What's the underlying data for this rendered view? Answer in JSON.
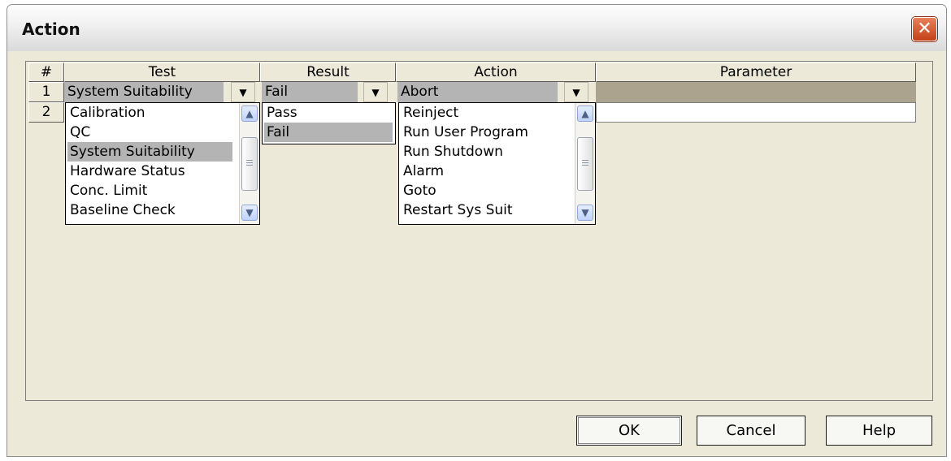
{
  "window": {
    "title": "Action",
    "close_glyph": "✕"
  },
  "grid": {
    "headers": {
      "num": "#",
      "test": "Test",
      "result": "Result",
      "action": "Action",
      "parameter": "Parameter"
    },
    "rows": [
      {
        "num": "1",
        "test": "System Suitability",
        "result": "Fail",
        "action": "Abort",
        "parameter": ""
      },
      {
        "num": "2"
      }
    ],
    "parameter_highlight_color": "#aba38e"
  },
  "dropdowns": {
    "test": {
      "items": [
        "Calibration",
        "QC",
        "System Suitability",
        "Hardware Status",
        "Conc. Limit",
        "Baseline Check"
      ],
      "selected": "System Suitability"
    },
    "result": {
      "items": [
        "Pass",
        "Fail"
      ],
      "selected": "Fail"
    },
    "action": {
      "items": [
        "Reinject",
        "Run User Program",
        "Run Shutdown",
        "Alarm",
        "Goto",
        "Restart Sys Suit"
      ],
      "selected": ""
    }
  },
  "icons": {
    "dropdown_arrow": "▼",
    "scroll_up": "▲",
    "scroll_down": "▼"
  },
  "buttons": {
    "ok": "OK",
    "cancel": "Cancel",
    "help": "Help"
  },
  "colors": {
    "close_button": "#c44118",
    "selection": "#b4b4b4",
    "dialog_bg": "#ece9d8"
  }
}
